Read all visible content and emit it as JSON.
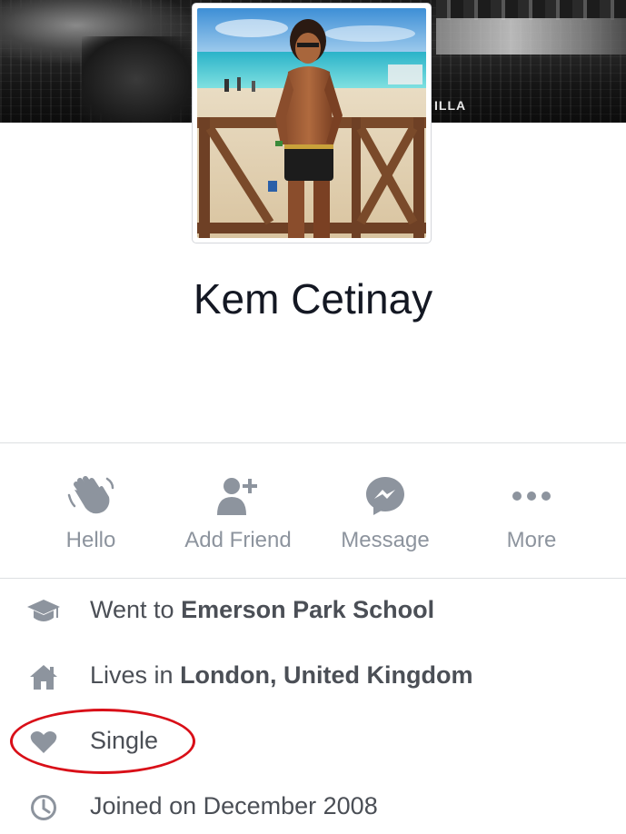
{
  "cover": {
    "overlay_text": "ILLA"
  },
  "profile": {
    "name": "Kem Cetinay"
  },
  "actions": [
    {
      "label": "Hello",
      "icon": "wave-icon"
    },
    {
      "label": "Add Friend",
      "icon": "add-friend-icon"
    },
    {
      "label": "Message",
      "icon": "messenger-icon"
    },
    {
      "label": "More",
      "icon": "more-icon"
    }
  ],
  "about": {
    "education": {
      "prefix": "Went to ",
      "value": "Emerson Park School",
      "icon": "graduation-cap-icon"
    },
    "location": {
      "prefix": "Lives in ",
      "value": "London, United Kingdom",
      "icon": "home-icon"
    },
    "relationship": {
      "value": "Single",
      "icon": "heart-icon",
      "highlight_color": "#d90f18"
    },
    "joined": {
      "value": "Joined on December 2008",
      "icon": "clock-icon"
    }
  },
  "colors": {
    "name_text": "#141823",
    "action_gray": "#8d949e",
    "about_text": "#4b4f56",
    "divider": "#dddfe2"
  }
}
